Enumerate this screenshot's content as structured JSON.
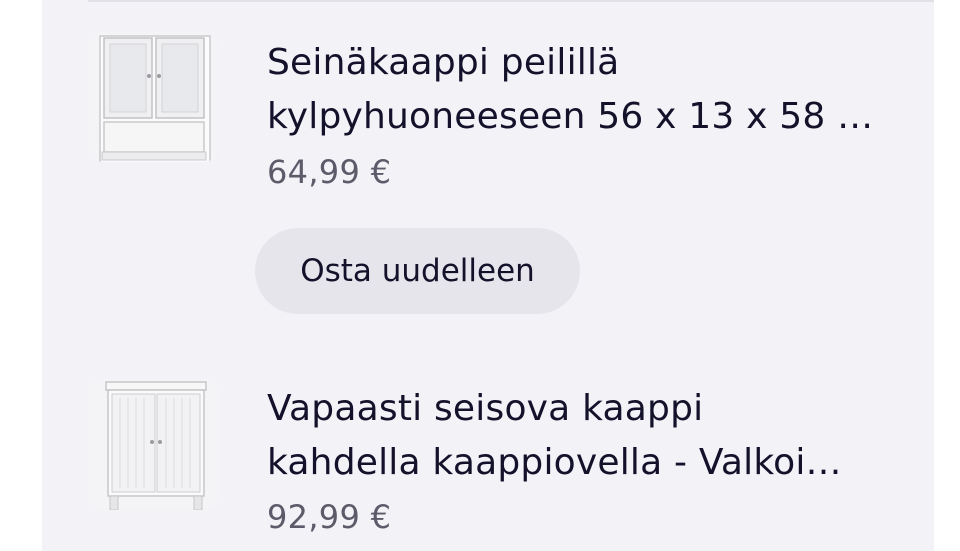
{
  "order_items": [
    {
      "image_icon": "wall-cabinet-with-mirror-image",
      "title_lines": [
        "Seinäkaappi peilillä",
        "kylpyhuoneeseen 56 x 13 x 58 …"
      ],
      "price": "64,99 €",
      "rebuy_label": "Osta uudelleen"
    },
    {
      "image_icon": "freestanding-cabinet-image",
      "title_lines": [
        "Vapaasti seisova kaappi",
        "kahdella kaappiovella - Valkoi…"
      ],
      "price": "92,99 €"
    }
  ],
  "colors": {
    "panel_background": "#f3f2f7",
    "title_text": "#14122b",
    "price_text": "#5d5b6a",
    "button_background": "#e6e5eb"
  }
}
